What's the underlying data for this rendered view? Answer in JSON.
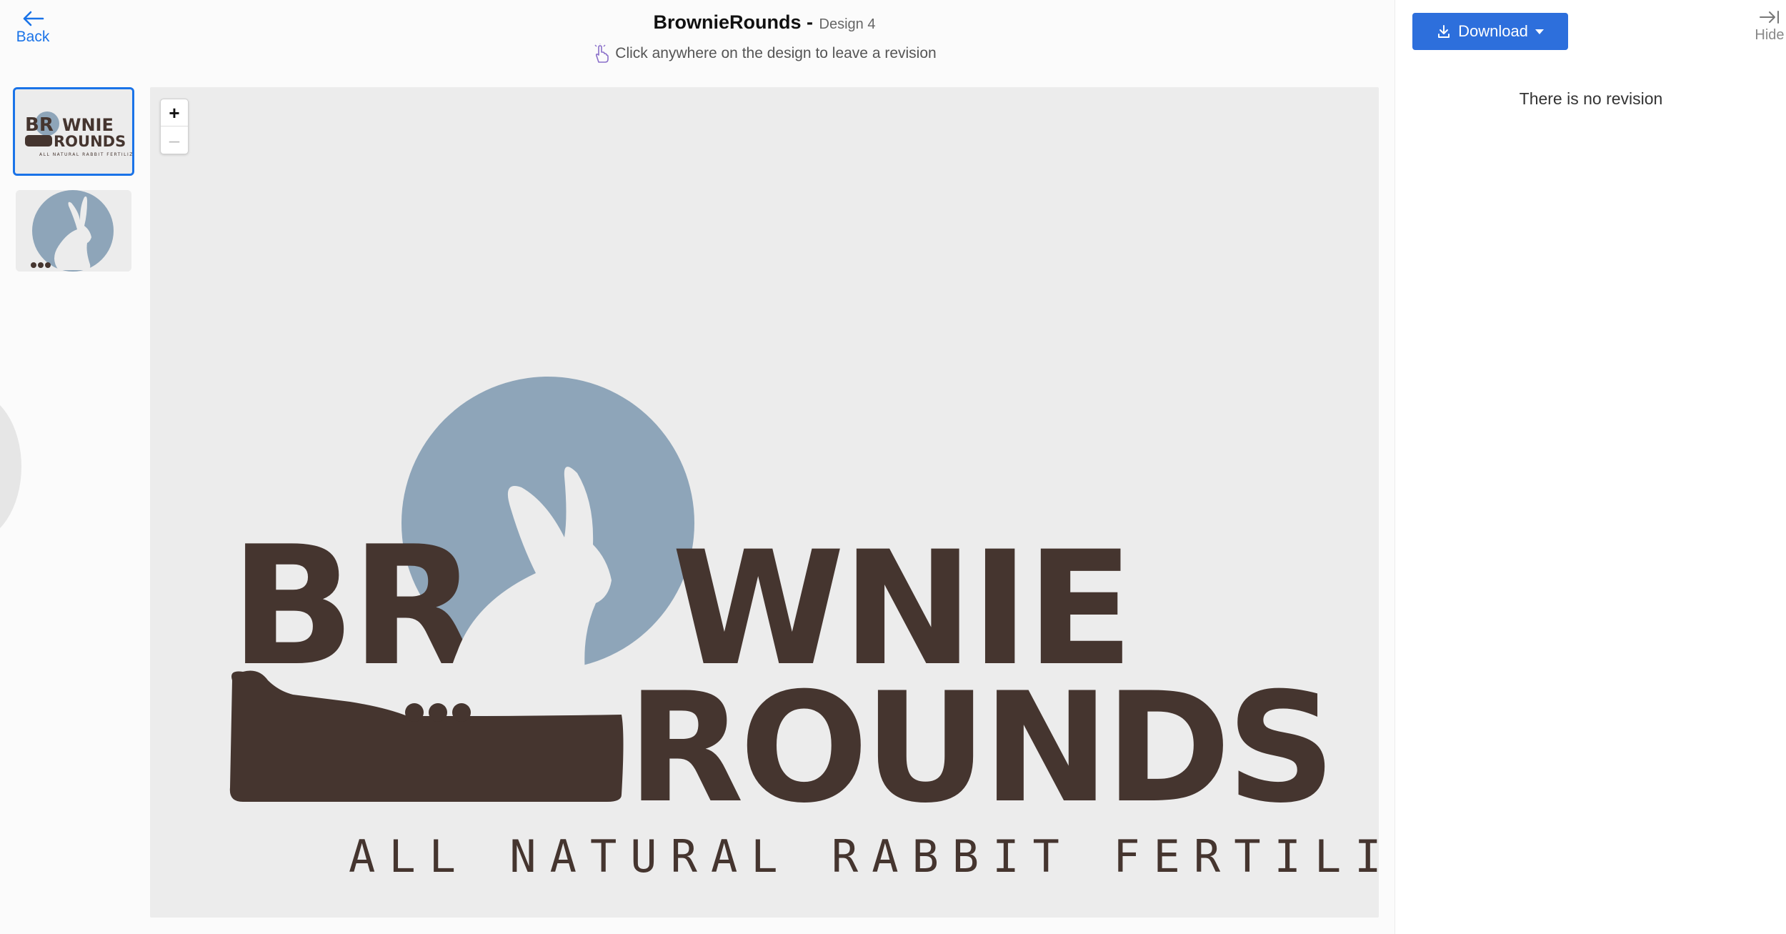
{
  "header": {
    "back_label": "Back",
    "project_title": "BrownieRounds",
    "title_separator": " -",
    "design_label": "Design 4",
    "hint_text": "Click anywhere on the design to leave a revision"
  },
  "icons": {
    "back": "arrow-left-icon",
    "hint": "pointer-hand-icon",
    "download": "download-icon",
    "hide": "collapse-right-icon"
  },
  "thumbnails": [
    {
      "name": "thumbnail-logo-full",
      "selected": true
    },
    {
      "name": "thumbnail-rabbit-icon",
      "selected": false
    }
  ],
  "zoom": {
    "in_label": "+",
    "out_label": "–"
  },
  "logo": {
    "word1_left": "BR",
    "word1_right": "WNIE",
    "word2": "ROUNDS",
    "tagline": "ALL NATURAL RABBIT FERTILIZER",
    "thumb_word1": "BR WNIE",
    "thumb_word2": "ROUNDS",
    "thumb_tagline": "ALL NATURAL RABBIT FERTILIZER",
    "colors": {
      "brown": "#45352f",
      "blue": "#8ea5b9",
      "rabbit": "#ececec"
    }
  },
  "panel": {
    "download_label": "Download",
    "hide_label": "Hide",
    "empty_text": "There is no revision"
  },
  "colors": {
    "accent": "#1a73e8",
    "button": "#2d6fdc"
  }
}
